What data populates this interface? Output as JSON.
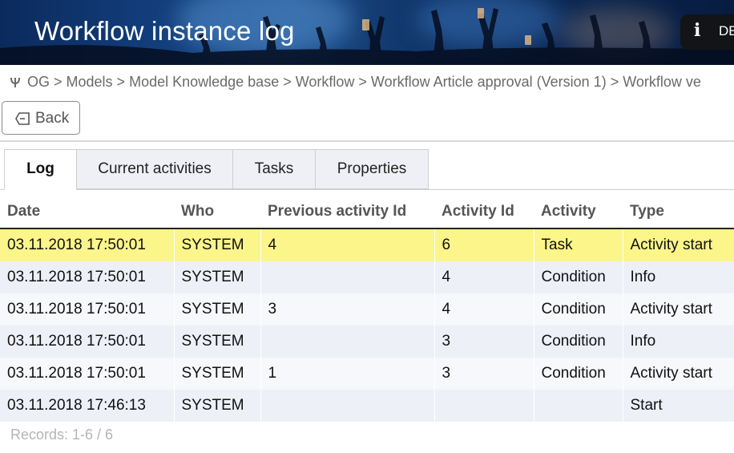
{
  "header": {
    "title": "Workflow instance log",
    "info_icon": "info-icon",
    "language": "DE"
  },
  "breadcrumb": {
    "icon": "home-icon",
    "text": "OG > Models > Model Knowledge base > Workflow > Workflow Article approval (Version 1) > Workflow ve"
  },
  "back_button": {
    "label": "Back",
    "icon": "back-icon"
  },
  "tabs": [
    {
      "label": "Log",
      "active": true
    },
    {
      "label": "Current activities",
      "active": false
    },
    {
      "label": "Tasks",
      "active": false
    },
    {
      "label": "Properties",
      "active": false
    }
  ],
  "table": {
    "columns": [
      "Date",
      "Who",
      "Previous activity Id",
      "Activity Id",
      "Activity",
      "Type"
    ],
    "rows": [
      [
        "03.11.2018 17:50:01",
        "SYSTEM",
        "4",
        "6",
        "Task",
        "Activity start"
      ],
      [
        "03.11.2018 17:50:01",
        "SYSTEM",
        "",
        "4",
        "Condition",
        "Info"
      ],
      [
        "03.11.2018 17:50:01",
        "SYSTEM",
        "3",
        "4",
        "Condition",
        "Activity start"
      ],
      [
        "03.11.2018 17:50:01",
        "SYSTEM",
        "",
        "3",
        "Condition",
        "Info"
      ],
      [
        "03.11.2018 17:50:01",
        "SYSTEM",
        "1",
        "3",
        "Condition",
        "Activity start"
      ],
      [
        "03.11.2018 17:46:13",
        "SYSTEM",
        "",
        "",
        "",
        "Start"
      ]
    ],
    "selected_row": 0
  },
  "records": "Records: 1-6 / 6",
  "colors": {
    "header_bg": "#123d7a",
    "selected_row": "#fbf58a",
    "alt_row": "#eef0f7"
  }
}
